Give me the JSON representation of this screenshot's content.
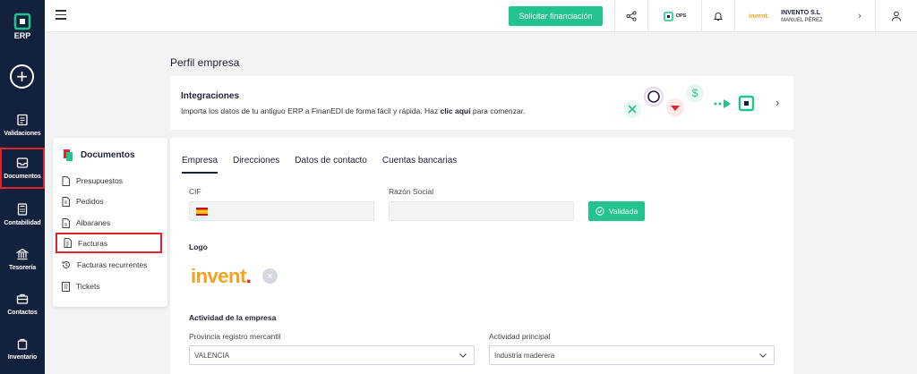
{
  "app": {
    "logo_text": "ERP"
  },
  "rail": {
    "items": [
      {
        "label": "Validaciones",
        "icon": "clipboard-icon"
      },
      {
        "label": "Documentos",
        "icon": "inbox-icon",
        "active": true
      },
      {
        "label": "Contabilidad",
        "icon": "calculator-icon"
      },
      {
        "label": "Tesorería",
        "icon": "bank-icon"
      },
      {
        "label": "Contactos",
        "icon": "briefcase-icon"
      },
      {
        "label": "Inventario",
        "icon": "bag-icon"
      }
    ]
  },
  "topbar": {
    "finance_button": "Solicitar financiación",
    "ops_label": "OPS",
    "company": {
      "logo_text": "invent.",
      "name": "INVENTO S.L",
      "user": "MANUEL PÉREZ"
    }
  },
  "page": {
    "title": "Perfil empresa"
  },
  "banner": {
    "title": "Integraciones",
    "text_before": "Importa los datos de tu antiguo ERP a FinanEDI de forma fácil y rápida. Haz ",
    "link": "clic aquí",
    "text_after": " para comenzar."
  },
  "docs_menu": {
    "title": "Documentos",
    "items": [
      {
        "label": "Presupuestos",
        "icon": "document-icon"
      },
      {
        "label": "Pedidos",
        "icon": "document-icon"
      },
      {
        "label": "Albaranes",
        "icon": "document-icon"
      },
      {
        "label": "Facturas",
        "icon": "document-icon",
        "active": true
      },
      {
        "label": "Facturas recurrentes",
        "icon": "history-icon"
      },
      {
        "label": "Tickets",
        "icon": "ticket-icon"
      }
    ]
  },
  "tabs": [
    {
      "label": "Empresa",
      "active": true
    },
    {
      "label": "Direcciones"
    },
    {
      "label": "Datos de contacto"
    },
    {
      "label": "Cuentas bancarias"
    }
  ],
  "form": {
    "cif_label": "CIF",
    "cif_value": "",
    "razon_label": "Razón Social",
    "razon_value": "",
    "validated_label": "Validada",
    "logo_section": "Logo",
    "logo_text": "invent",
    "logo_dot": ".",
    "activity_section": "Actividad de la empresa",
    "provincia_label": "Provincia registro mercantil",
    "provincia_value": "VALENCIA",
    "actividad_label": "Actividad principal",
    "actividad_value": "Industria maderera"
  },
  "colors": {
    "primary": "#14213d",
    "accent": "#22c38e",
    "highlight": "#e2222c",
    "brand_orange": "#f2a21e"
  }
}
